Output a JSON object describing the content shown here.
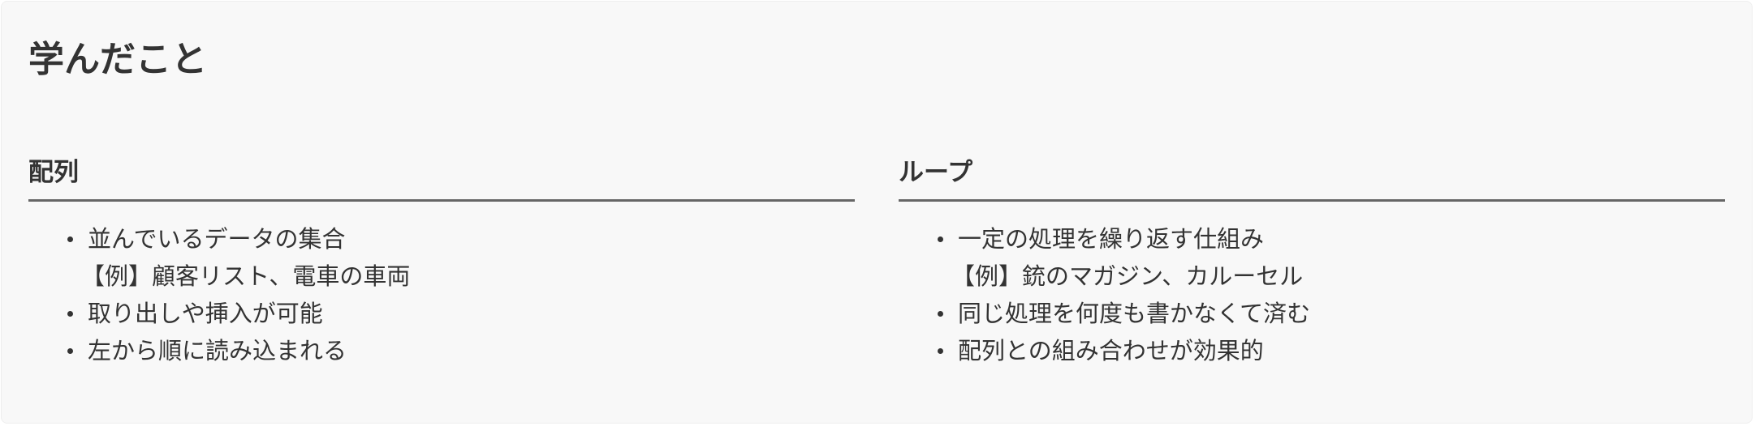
{
  "page": {
    "title": "学んだこと"
  },
  "columns": [
    {
      "heading": "配列",
      "items": [
        {
          "text": "並んでいるデータの集合",
          "example": "【例】顧客リスト、電車の車両"
        },
        {
          "text": "取り出しや挿入が可能"
        },
        {
          "text": "左から順に読み込まれる"
        }
      ]
    },
    {
      "heading": "ループ",
      "items": [
        {
          "text": "一定の処理を繰り返す仕組み",
          "example": "【例】銃のマガジン、カルーセル"
        },
        {
          "text": "同じ処理を何度も書かなくて済む"
        },
        {
          "text": "配列との組み合わせが効果的"
        }
      ]
    }
  ],
  "colors": {
    "background": "#f8f8f8",
    "text": "#333333",
    "rule": "#666666"
  }
}
